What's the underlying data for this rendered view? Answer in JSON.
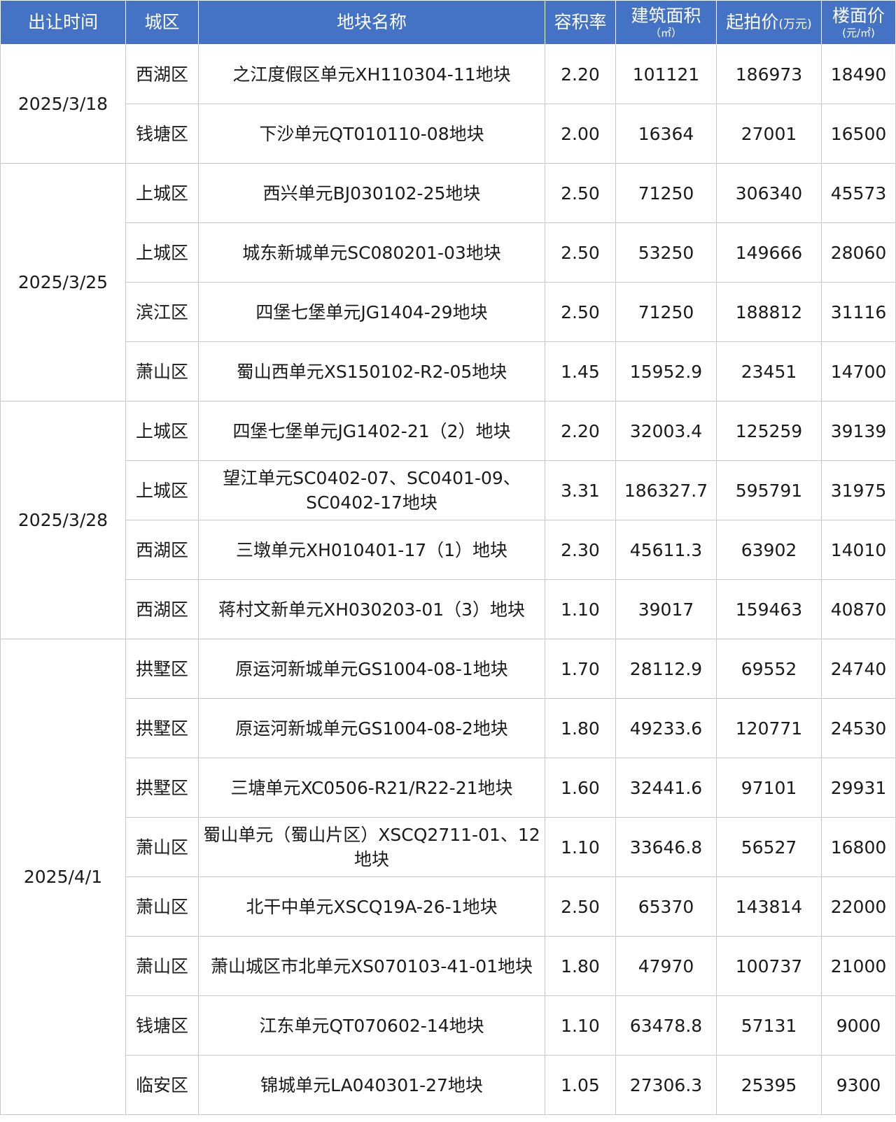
{
  "header": {
    "date": "出让时间",
    "district": "城区",
    "name": "地块名称",
    "far": "容积率",
    "area": "建筑面积",
    "area_unit": "（㎡）",
    "price": "起拍价",
    "price_unit": "(万元)",
    "floor_price": "楼面价",
    "floor_price_unit": "(元/㎡)"
  },
  "groups": [
    {
      "date": "2025/3/18",
      "rows": [
        {
          "district": "西湖区",
          "name": "之江度假区单元XH110304-11地块",
          "far": "2.20",
          "area": "101121",
          "price": "186973",
          "floor_price": "18490"
        },
        {
          "district": "钱塘区",
          "name": "下沙单元QT010110-08地块",
          "far": "2.00",
          "area": "16364",
          "price": "27001",
          "floor_price": "16500"
        }
      ]
    },
    {
      "date": "2025/3/25",
      "rows": [
        {
          "district": "上城区",
          "name": "西兴单元BJ030102-25地块",
          "far": "2.50",
          "area": "71250",
          "price": "306340",
          "floor_price": "45573"
        },
        {
          "district": "上城区",
          "name": "城东新城单元SC080201-03地块",
          "far": "2.50",
          "area": "53250",
          "price": "149666",
          "floor_price": "28060"
        },
        {
          "district": "滨江区",
          "name": "四堡七堡单元JG1404-29地块",
          "far": "2.50",
          "area": "71250",
          "price": "188812",
          "floor_price": "31116"
        },
        {
          "district": "萧山区",
          "name": "蜀山西单元XS150102-R2-05地块",
          "far": "1.45",
          "area": "15952.9",
          "price": "23451",
          "floor_price": "14700"
        }
      ]
    },
    {
      "date": "2025/3/28",
      "rows": [
        {
          "district": "上城区",
          "name": "四堡七堡单元JG1402-21（2）地块",
          "far": "2.20",
          "area": "32003.4",
          "price": "125259",
          "floor_price": "39139"
        },
        {
          "district": "上城区",
          "name": "望江单元SC0402-07、SC0401-09、SC0402-17地块",
          "far": "3.31",
          "area": "186327.7",
          "price": "595791",
          "floor_price": "31975"
        },
        {
          "district": "西湖区",
          "name": "三墩单元XH010401-17（1）地块",
          "far": "2.30",
          "area": "45611.3",
          "price": "63902",
          "floor_price": "14010"
        },
        {
          "district": "西湖区",
          "name": "蒋村文新单元XH030203-01（3）地块",
          "far": "1.10",
          "area": "39017",
          "price": "159463",
          "floor_price": "40870"
        }
      ]
    },
    {
      "date": "2025/4/1",
      "rows": [
        {
          "district": "拱墅区",
          "name": "原运河新城单元GS1004-08-1地块",
          "far": "1.70",
          "area": "28112.9",
          "price": "69552",
          "floor_price": "24740"
        },
        {
          "district": "拱墅区",
          "name": "原运河新城单元GS1004-08-2地块",
          "far": "1.80",
          "area": "49233.6",
          "price": "120771",
          "floor_price": "24530"
        },
        {
          "district": "拱墅区",
          "name": "三塘单元XC0506-R21/R22-21地块",
          "far": "1.60",
          "area": "32441.6",
          "price": "97101",
          "floor_price": "29931"
        },
        {
          "district": "萧山区",
          "name": "蜀山单元（蜀山片区）XSCQ2711-01、12地块",
          "far": "1.10",
          "area": "33646.8",
          "price": "56527",
          "floor_price": "16800"
        },
        {
          "district": "萧山区",
          "name": "北干中单元XSCQ19A-26-1地块",
          "far": "2.50",
          "area": "65370",
          "price": "143814",
          "floor_price": "22000"
        },
        {
          "district": "萧山区",
          "name": "萧山城区市北单元XS070103-41-01地块",
          "far": "1.80",
          "area": "47970",
          "price": "100737",
          "floor_price": "21000"
        },
        {
          "district": "钱塘区",
          "name": "江东单元QT070602-14地块",
          "far": "1.10",
          "area": "63478.8",
          "price": "57131",
          "floor_price": "9000"
        },
        {
          "district": "临安区",
          "name": "锦城单元LA040301-27地块",
          "far": "1.05",
          "area": "27306.3",
          "price": "25395",
          "floor_price": "9300"
        }
      ]
    }
  ]
}
